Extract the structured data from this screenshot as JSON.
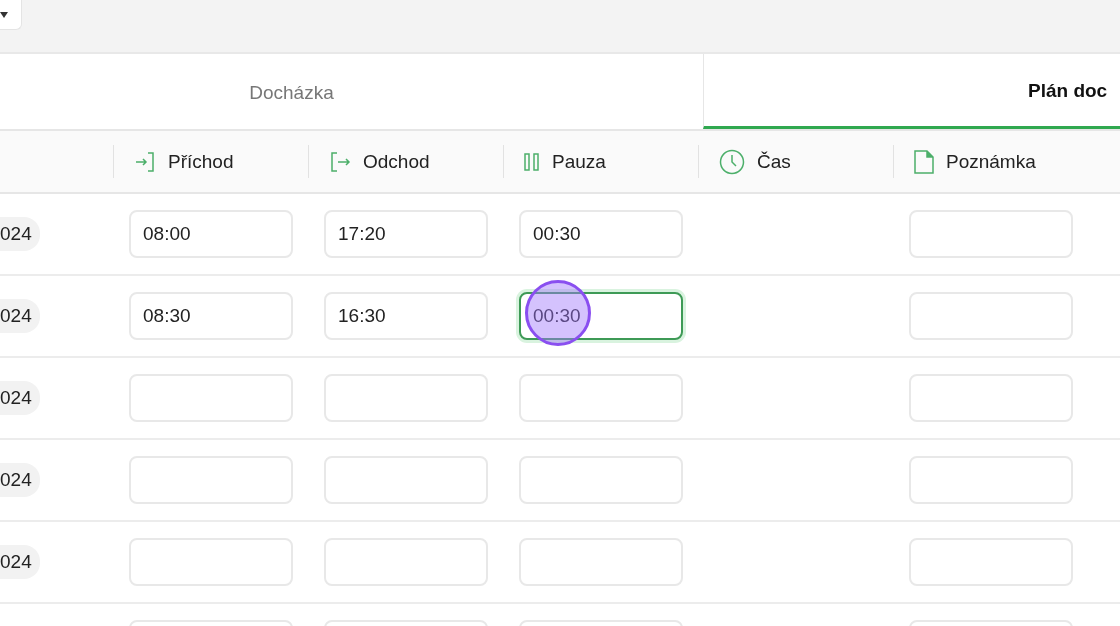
{
  "tabs": [
    {
      "label": "Docházka",
      "selected": false
    },
    {
      "label": "Plán doc",
      "selected": true
    }
  ],
  "columns": [
    {
      "label": "Příchod",
      "kind": "arrival"
    },
    {
      "label": "Odchod",
      "kind": "departure"
    },
    {
      "label": "Pauza",
      "kind": "pause"
    },
    {
      "label": "Čas",
      "kind": "time"
    },
    {
      "label": "Poznámka",
      "kind": "note"
    }
  ],
  "rows": [
    {
      "date": "024",
      "arrival": {
        "value": "08:00"
      },
      "departure": {
        "value": "17:20"
      },
      "pause": {
        "value": "00:30"
      },
      "note": {}
    },
    {
      "date": "024",
      "arrival": {
        "value": "08:30"
      },
      "departure": {
        "value": "16:30"
      },
      "pause": {
        "value": "00:30",
        "focused": true,
        "clicked": true
      },
      "note": {}
    },
    {
      "date": "024",
      "arrival": {},
      "departure": {},
      "pause": {},
      "note": {}
    },
    {
      "date": "024",
      "arrival": {},
      "departure": {},
      "pause": {},
      "note": {}
    },
    {
      "date": "024",
      "arrival": {},
      "departure": {},
      "pause": {},
      "note": {}
    },
    {
      "arrival": {},
      "departure": {},
      "pause": {},
      "note": {}
    }
  ]
}
